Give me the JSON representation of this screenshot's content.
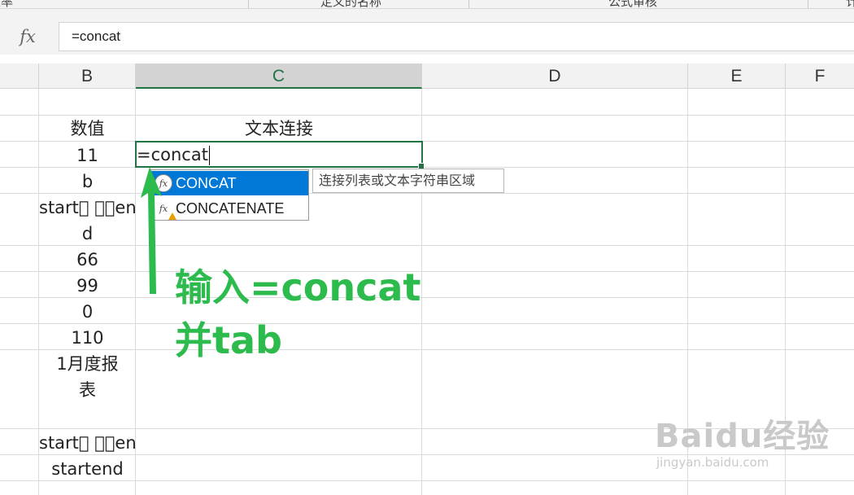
{
  "ribbon": {
    "fragments": [
      "效率",
      "定义的名称",
      "公式审核",
      "计"
    ]
  },
  "formula_bar": {
    "fx_label": "fx",
    "value": "=concat"
  },
  "columns": [
    "B",
    "C",
    "D",
    "E",
    "F"
  ],
  "selected_column": "C",
  "cells": {
    "header_b": "数值",
    "header_c": "文本连接",
    "b_values": [
      "11",
      "b",
      "start\u0000 \u0000\u0000en",
      "d",
      "66",
      "99",
      "0",
      "110",
      "1月度报",
      "表",
      "start\u0000 \u0000\u0000end",
      "startend"
    ]
  },
  "active_cell": {
    "text": "=concat"
  },
  "autocomplete": {
    "items": [
      {
        "label": "CONCAT",
        "selected": true,
        "icon": "function-icon"
      },
      {
        "label": "CONCATENATE",
        "selected": false,
        "icon": "function-warning-icon"
      }
    ],
    "tooltip": "连接列表或文本字符串区域"
  },
  "annotation": {
    "line1": "输入=concat",
    "line2": "并tab",
    "color": "#2dbb4e"
  },
  "watermark": {
    "brand": "Baidu经验",
    "url": "jingyan.baidu.com"
  },
  "colors": {
    "accent_green": "#217346",
    "selection_blue": "#0078d7"
  }
}
